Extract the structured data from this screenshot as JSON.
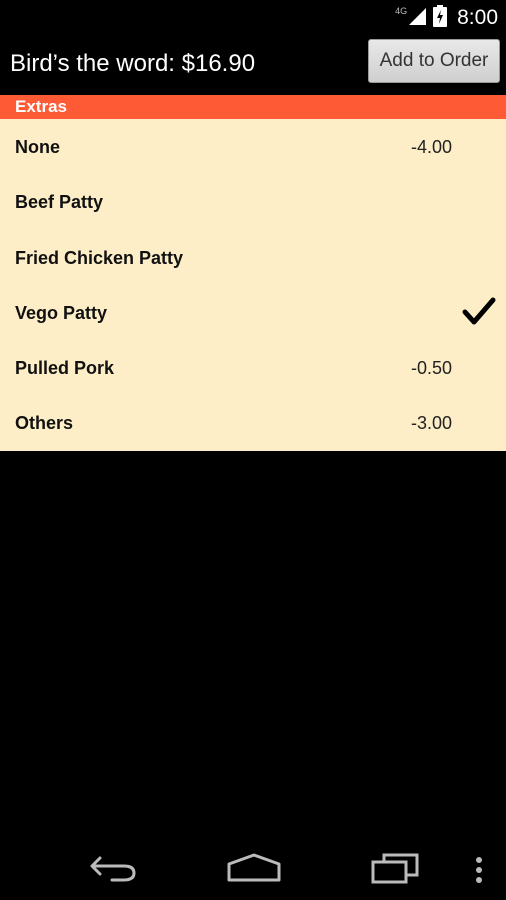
{
  "status_bar": {
    "network_label": "4G",
    "time": "8:00",
    "icons": [
      "signal-icon",
      "battery-icon"
    ]
  },
  "header": {
    "title": "Bird’s the word: $16.90",
    "add_button_label": "Add to Order"
  },
  "section": {
    "title": "Extras"
  },
  "options": [
    {
      "label": "None",
      "price": "-4.00",
      "selected": false
    },
    {
      "label": "Beef Patty",
      "price": "",
      "selected": false
    },
    {
      "label": "Fried Chicken Patty",
      "price": "",
      "selected": false
    },
    {
      "label": "Vego Patty",
      "price": "",
      "selected": true
    },
    {
      "label": "Pulled Pork",
      "price": "-0.50",
      "selected": false
    },
    {
      "label": "Others",
      "price": "-3.00",
      "selected": false
    }
  ],
  "colors": {
    "section_header_bg": "#ff5a36",
    "list_bg": "#fdeec8",
    "page_bg": "#000000"
  },
  "nav_bar": {
    "icons": [
      "back-icon",
      "home-icon",
      "recent-apps-icon",
      "overflow-menu-icon"
    ]
  }
}
